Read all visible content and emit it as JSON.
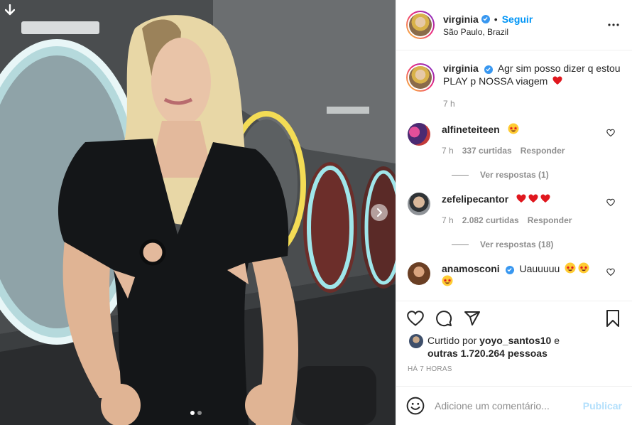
{
  "post": {
    "author": {
      "username": "virginia",
      "verified": true,
      "follow_label": "Seguir",
      "separator": "•",
      "location": "São Paulo, Brazil"
    },
    "carousel": {
      "slide_count": 2,
      "active_slide": 1
    },
    "caption": {
      "username": "virginia",
      "text": "Agr sim posso dizer q estou PLAY p NOSSA viagem",
      "emoji": "red-heart",
      "time": "7 h"
    },
    "comments": [
      {
        "username": "alfineteiteen",
        "verified": false,
        "text": "",
        "emojis": [
          "star-struck"
        ],
        "time": "7 h",
        "likes": "337 curtidas",
        "reply_label": "Responder",
        "view_replies": "Ver respostas (1)",
        "avatar_color": "#5a2a6e"
      },
      {
        "username": "zefelipecantor",
        "verified": true,
        "text": "",
        "emojis": [
          "red-heart",
          "red-heart",
          "red-heart"
        ],
        "time": "7 h",
        "likes": "2.082 curtidas",
        "reply_label": "Responder",
        "view_replies": "Ver respostas (18)",
        "avatar_color": "#6b6f73"
      },
      {
        "username": "anamosconi",
        "verified": true,
        "text": "Uauuuuu",
        "emojis": [
          "star-struck",
          "star-struck",
          "star-struck"
        ],
        "avatar_color": "#8a5a3c"
      }
    ],
    "likes": {
      "prefix": "Curtido por",
      "user": "yoyo_santos10",
      "joiner": "e",
      "others": "outras 1.720.264 pessoas"
    },
    "time_ago": "HÁ 7 HORAS",
    "add_comment": {
      "placeholder": "Adicione um comentário...",
      "publish_label": "Publicar"
    }
  },
  "colors": {
    "accent": "#0095f6",
    "verified": "#3897f0",
    "heart": "#ed4956",
    "publish_disabled": "#b2dffc",
    "muted_text": "#8e8e8e"
  },
  "icons": [
    "download-icon",
    "chevron-right-icon",
    "more-options-icon",
    "verified-badge-icon",
    "heart-icon",
    "comment-icon",
    "share-icon",
    "bookmark-icon",
    "emoji-icon"
  ]
}
